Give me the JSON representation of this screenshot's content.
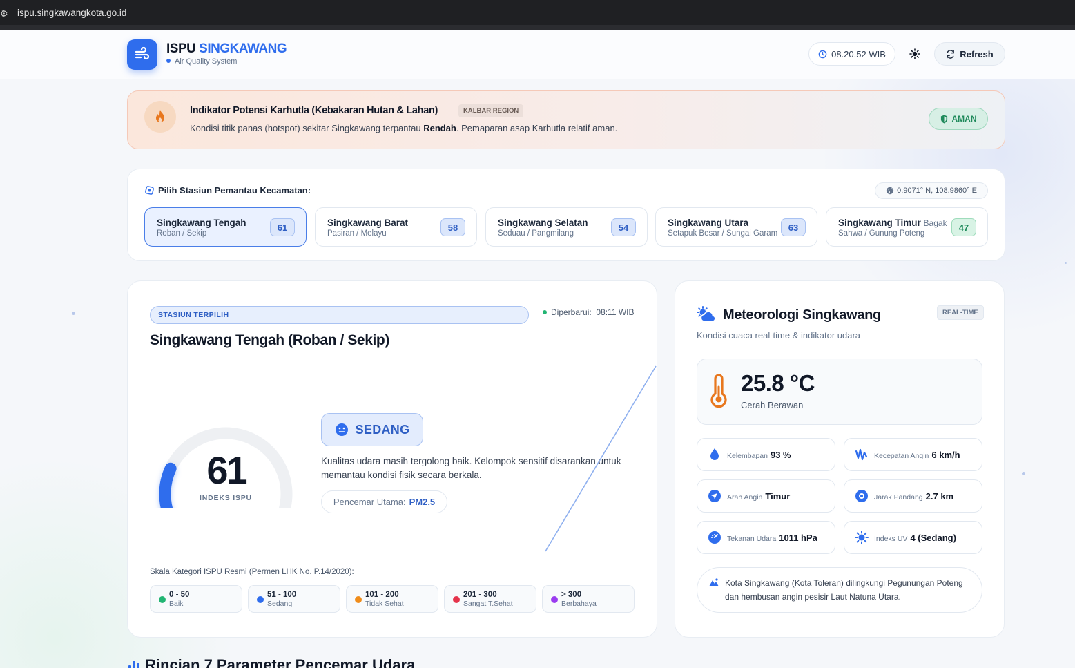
{
  "browser": {
    "url": "ispu.singkawangkota.go.id"
  },
  "header": {
    "brand_main": "ISPU",
    "brand_accent": "SINGKAWANG",
    "subtitle": "Air Quality System",
    "time": "08.20.52 WIB",
    "refresh_label": "Refresh"
  },
  "alert": {
    "title": "Indikator Potensi Karhutla (Kebakaran Hutan & Lahan)",
    "tag": "KALBAR REGION",
    "text_before": "Kondisi titik panas (hotspot) sekitar Singkawang terpantau ",
    "text_bold": "Rendah",
    "text_after": ". Pemaparan asap Karhutla relatif aman.",
    "status": "AMAN"
  },
  "stations": {
    "label": "Pilih Stasiun Pemantau Kecamatan:",
    "coords": "0.9071° N, 108.9860° E",
    "items": [
      {
        "name": "Singkawang Tengah",
        "extra": "",
        "sub": "Roban / Sekip",
        "value": "61"
      },
      {
        "name": "Singkawang Barat",
        "extra": "",
        "sub": "Pasiran / Melayu",
        "value": "58"
      },
      {
        "name": "Singkawang Selatan",
        "extra": "",
        "sub": "Seduau / Pangmilang",
        "value": "54"
      },
      {
        "name": "Singkawang Utara",
        "extra": "",
        "sub": "Setapuk Besar / Sungai Garam",
        "value": "63"
      },
      {
        "name": "Singkawang Timur",
        "extra": "Bagak",
        "sub": "Sahwa / Gunung Poteng",
        "value": "47"
      }
    ]
  },
  "main": {
    "tag": "STASIUN TERPILIH",
    "updated_label": "Diperbarui:",
    "updated_time": "08:11 WIB",
    "title": "Singkawang Tengah (Roban / Sekip)",
    "index_value": 61,
    "index_label": "INDEKS ISPU",
    "category": "SEDANG",
    "description": "Kualitas udara masih tergolong baik. Kelompok sensitif disarankan untuk memantau kondisi fisik secara berkala.",
    "pollutant_label": "Pencemar Utama:",
    "pollutant_value": "PM2.5",
    "scale_title": "Skala Kategori ISPU Resmi (Permen LHK No. P.14/2020):",
    "scale": [
      {
        "range": "0 - 50",
        "category": "Baik",
        "color": "#22b573"
      },
      {
        "range": "51 - 100",
        "category": "Sedang",
        "color": "#2f6ded"
      },
      {
        "range": "101 - 200",
        "category": "Tidak Sehat",
        "color": "#f08c1a"
      },
      {
        "range": "201 - 300",
        "category": "Sangat T.Sehat",
        "color": "#e5334b"
      },
      {
        "range": "> 300",
        "category": "Berbahaya",
        "color": "#9b3cf0"
      }
    ]
  },
  "meteo": {
    "title": "Meteorologi Singkawang",
    "tag": "REAL-TIME",
    "subtitle": "Kondisi cuaca real-time & indikator udara",
    "temperature": "25.8 °C",
    "condition": "Cerah Berawan",
    "items": [
      {
        "label": "Kelembapan",
        "value": "93 %"
      },
      {
        "label": "Kecepatan Angin",
        "value": "6 km/h"
      },
      {
        "label": "Arah Angin",
        "value": "Timur"
      },
      {
        "label": "Jarak Pandang",
        "value": "2.7 km"
      },
      {
        "label": "Tekanan Udara",
        "value": "1011 hPa"
      },
      {
        "label": "Indeks UV",
        "value": "4 (Sedang)"
      }
    ],
    "note": "Kota Singkawang (Kota Toleran) dilingkungi Pegunungan Poteng dan hembusan angin pesisir Laut Natuna Utara."
  },
  "next_section": {
    "title": "Rincian 7 Parameter Pencemar Udara"
  },
  "colors": {
    "accent": "#2f6ded",
    "safe": "#1f8a5b",
    "fire": "#e8771e"
  }
}
